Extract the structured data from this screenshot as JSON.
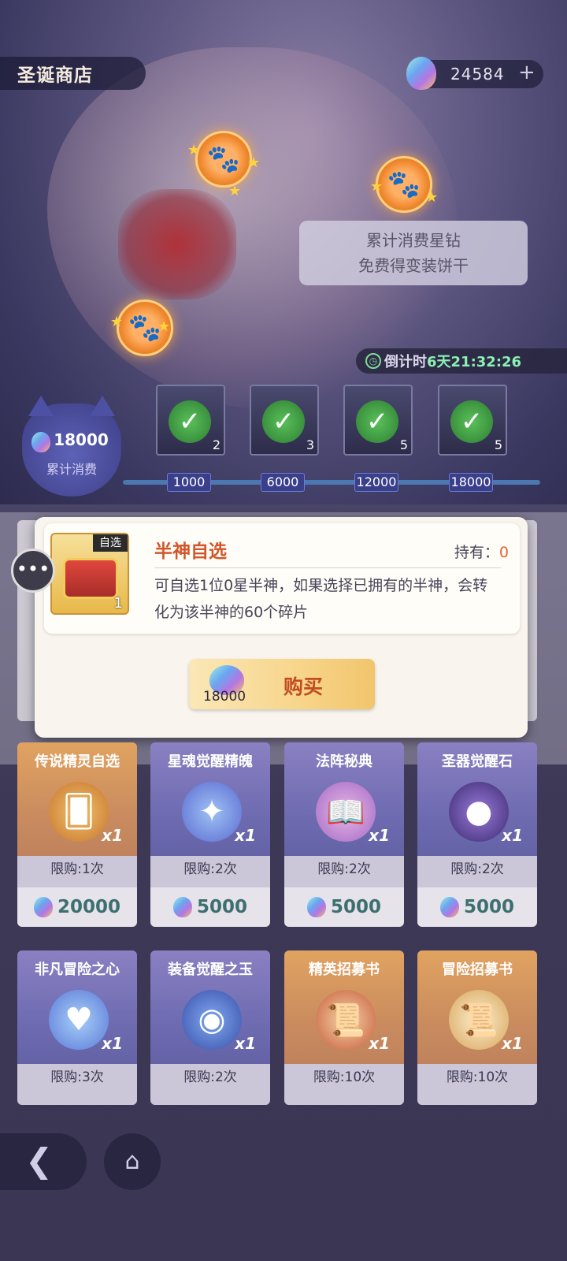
{
  "header": {
    "title": "圣诞商店",
    "currency_value": "24584",
    "plus": "+"
  },
  "promo": {
    "line1": "累计消费星钻",
    "line2": "免费得变装饼干"
  },
  "countdown": {
    "label": "倒计时",
    "time": "6天21:32:26"
  },
  "cumulative": {
    "value": "18000",
    "label": "累计消费"
  },
  "tiers": [
    {
      "count": "2",
      "milestone": "1000"
    },
    {
      "count": "3",
      "milestone": "6000"
    },
    {
      "count": "5",
      "milestone": "12000"
    },
    {
      "count": "5",
      "milestone": "18000"
    }
  ],
  "popup": {
    "item_tag": "自选",
    "item_qty": "1",
    "item_name": "半神自选",
    "hold_label": "持有：",
    "hold_value": "0",
    "description": "可自选1位0星半神，如果选择已拥有的半神，会转化为该半神的60个碎片",
    "price": "18000",
    "buy_label": "购买"
  },
  "cards": [
    {
      "name": "传说精灵自选",
      "qty": "x1",
      "limit": "限购:1次",
      "price": "20000",
      "style": "orange"
    },
    {
      "name": "星魂觉醒精魄",
      "qty": "x1",
      "limit": "限购:2次",
      "price": "5000",
      "style": "purple"
    },
    {
      "name": "法阵秘典",
      "qty": "x1",
      "limit": "限购:2次",
      "price": "5000",
      "style": "purple"
    },
    {
      "name": "圣器觉醒石",
      "qty": "x1",
      "limit": "限购:2次",
      "price": "5000",
      "style": "purple"
    },
    {
      "name": "非凡冒险之心",
      "qty": "x1",
      "limit": "限购:3次",
      "style": "purple"
    },
    {
      "name": "装备觉醒之玉",
      "qty": "x1",
      "limit": "限购:2次",
      "style": "purple"
    },
    {
      "name": "精英招募书",
      "qty": "x1",
      "limit": "限购:10次",
      "style": "orange"
    },
    {
      "name": "冒险招募书",
      "qty": "x1",
      "limit": "限购:10次",
      "style": "orange"
    }
  ],
  "icons": {
    "back": "back-arrow-icon",
    "home": "home-icon",
    "chat": "chat-bubble-icon",
    "paw": "paw-icon",
    "clock": "clock-icon"
  },
  "colors": {
    "accent": "#d2562a",
    "countdown": "#8cf0b4",
    "price_text": "#3d6f70"
  }
}
